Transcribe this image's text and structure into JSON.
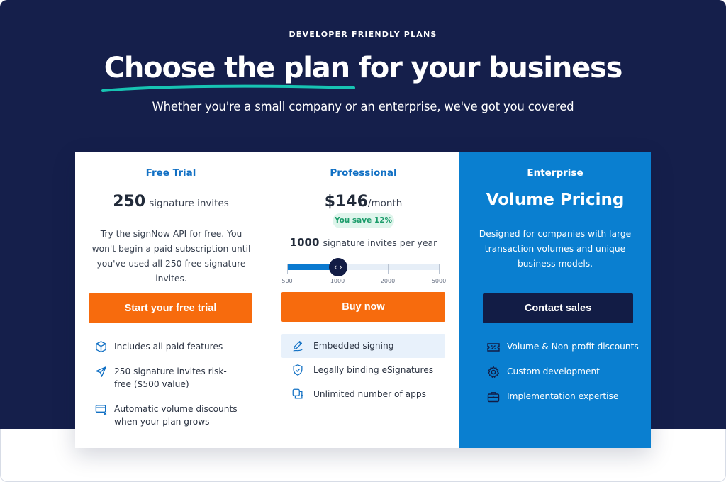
{
  "hero": {
    "eyebrow": "DEVELOPER FRIENDLY PLANS",
    "headline_underlined": "Choose the plan",
    "headline_rest": " for your business",
    "subheadline": "Whether you're a small company or an enterprise, we've got you covered"
  },
  "colors": {
    "hero_bg": "#151f4b",
    "accent_blue": "#1170c4",
    "cta_orange": "#f76b0d",
    "enterprise_bg": "#0a7fd0",
    "swoosh": "#17c3b2"
  },
  "plans": {
    "free": {
      "name": "Free Trial",
      "amount": "250",
      "amount_unit": "signature invites",
      "description": "Try the signNow API for free. You won't begin a paid subscription until you've used all 250 free signature invites.",
      "cta": "Start your free trial",
      "features": [
        {
          "icon": "box-icon",
          "text": "Includes all paid features"
        },
        {
          "icon": "send-icon",
          "text": "250 signature invites risk-free ($500 value)"
        },
        {
          "icon": "card-discount-icon",
          "text": "Automatic volume discounts when your plan grows"
        }
      ]
    },
    "professional": {
      "name": "Professional",
      "price": "$146",
      "price_unit": "/month",
      "badge": "You save 12%",
      "invites": "1000",
      "invites_unit": "signature invites per year",
      "slider": {
        "knob_glyph": "‹ ›",
        "labels": [
          "500",
          "1000",
          "2000",
          "5000"
        ],
        "selected": "1000"
      },
      "cta": "Buy now",
      "features": [
        {
          "icon": "pen-icon",
          "text": "Embedded signing",
          "active": true
        },
        {
          "icon": "shield-check-icon",
          "text": "Legally binding eSignatures",
          "active": false
        },
        {
          "icon": "apps-icon",
          "text": "Unlimited number of apps",
          "active": false
        }
      ]
    },
    "enterprise": {
      "name": "Enterprise",
      "title": "Volume Pricing",
      "description": "Designed for companies with large transaction volumes and unique business models.",
      "cta": "Contact sales",
      "features": [
        {
          "icon": "ticket-discount-icon",
          "text": "Volume & Non-profit discounts"
        },
        {
          "icon": "gear-icon",
          "text": "Custom development"
        },
        {
          "icon": "briefcase-icon",
          "text": "Implementation expertise"
        }
      ]
    }
  }
}
